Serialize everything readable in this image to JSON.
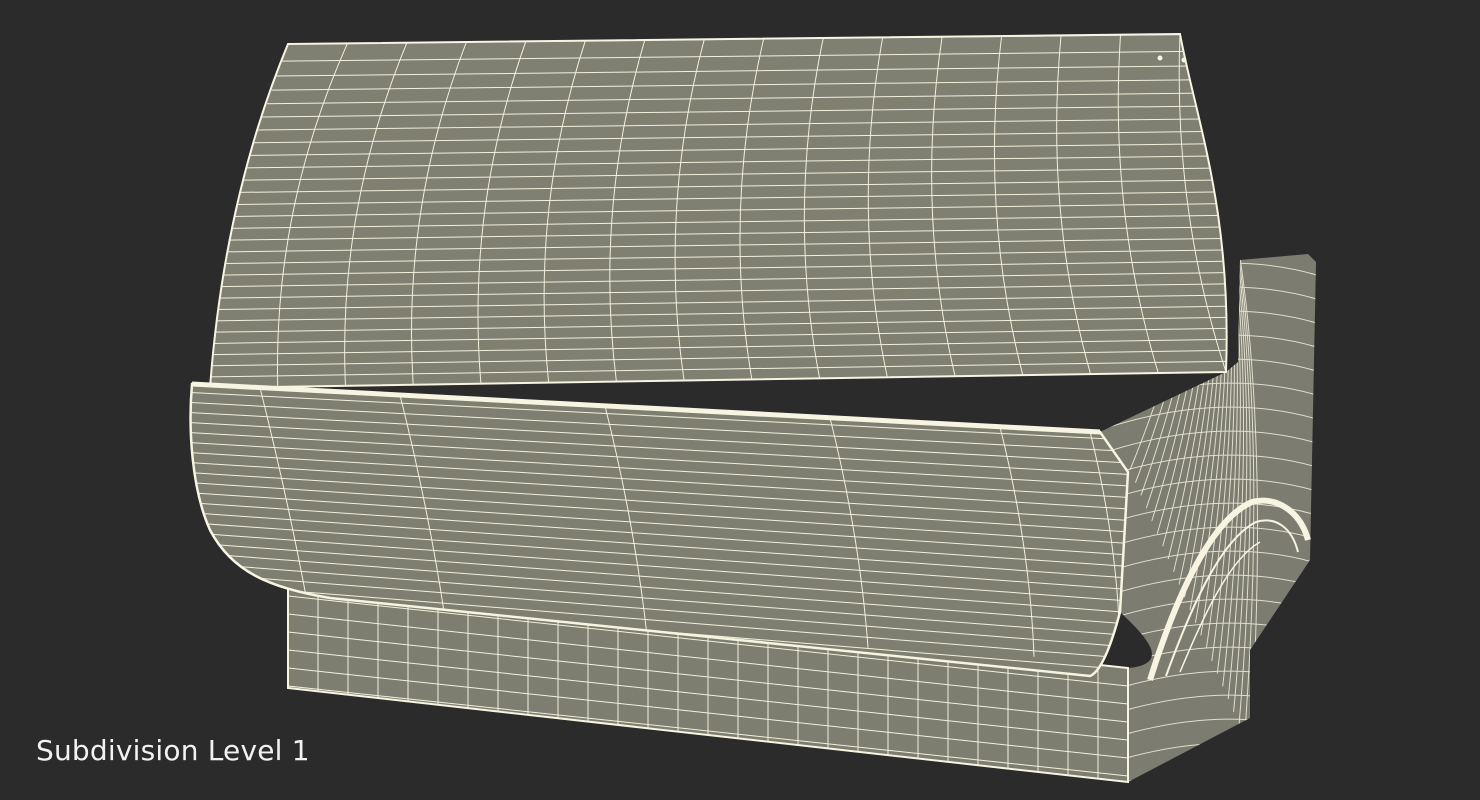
{
  "caption": "Subdivision Level 1",
  "colors": {
    "background": "#2b2b2b",
    "surface": "#7f7f72",
    "wire": "#f3f0dc",
    "caption": "#f2f2f2"
  },
  "render": {
    "subject": "wireframe-3d-model",
    "wire_color": "cream"
  }
}
